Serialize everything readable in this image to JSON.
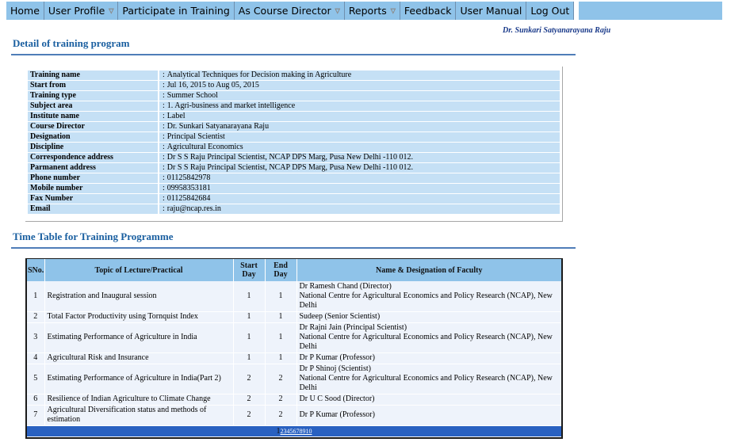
{
  "menu": {
    "items": [
      {
        "label": "Home",
        "dropdown": false
      },
      {
        "label": "User Profile",
        "dropdown": true
      },
      {
        "label": "Participate in Training",
        "dropdown": false
      },
      {
        "label": "As Course Director",
        "dropdown": true
      },
      {
        "label": "Reports",
        "dropdown": true
      },
      {
        "label": "Feedback",
        "dropdown": false
      },
      {
        "label": "User Manual",
        "dropdown": false
      },
      {
        "label": "Log Out",
        "dropdown": false
      }
    ],
    "dropdown_icon": "triangle-down-icon"
  },
  "user": {
    "name": "Dr. Sunkari Satyanarayana Raju"
  },
  "detail": {
    "title": "Detail of training program",
    "rows": [
      {
        "label": "Training name",
        "value": "Analytical Techniques for Decision making in Agriculture"
      },
      {
        "label": "Start from",
        "value": "Jul 16, 2015 to Aug 05, 2015"
      },
      {
        "label": "Training type",
        "value": "Summer School"
      },
      {
        "label": "Subject area",
        "value": "1. Agri-business and market intelligence"
      },
      {
        "label": "Institute name",
        "value": "Label"
      },
      {
        "label": "Course Director",
        "value": "Dr. Sunkari Satyanarayana Raju"
      },
      {
        "label": "Designation",
        "value": "Principal Scientist"
      },
      {
        "label": "Discipline",
        "value": "Agricultural Economics"
      },
      {
        "label": "Correspondence address",
        "value": "Dr S S Raju Principal Scientist, NCAP DPS Marg, Pusa New Delhi -110 012."
      },
      {
        "label": "Parmanent address",
        "value": "Dr S S Raju Principal Scientist, NCAP DPS Marg, Pusa New Delhi -110 012."
      },
      {
        "label": "Phone number",
        "value": "01125842978"
      },
      {
        "label": "Mobile number",
        "value": "09958353181"
      },
      {
        "label": "Fax Number",
        "value": "01125842684"
      },
      {
        "label": "Email",
        "value": "raju@ncap.res.in"
      }
    ],
    "separator": ":"
  },
  "timetable": {
    "title": "Time Table for Training Programme",
    "headers": {
      "sno": "SNo.",
      "topic": "Topic of Lecture/Practical",
      "start_day_1": "Start",
      "start_day_2": "Day",
      "end_day_1": "End",
      "end_day_2": "Day",
      "faculty": "Name & Designation of Faculty"
    },
    "rows": [
      {
        "sno": "1",
        "topic": "Registration and Inaugural session",
        "start": "1",
        "end": "1",
        "faculty": [
          "Dr Ramesh Chand (Director)",
          "National Centre for Agricultural Economics and Policy Research (NCAP), New Delhi"
        ]
      },
      {
        "sno": "2",
        "topic": "Total Factor Productivity using Tornquist Index",
        "start": "1",
        "end": "1",
        "faculty": [
          "Sudeep (Senior Scientist)"
        ]
      },
      {
        "sno": "3",
        "topic": "Estimating Performance of Agriculture in India",
        "start": "1",
        "end": "1",
        "faculty": [
          "Dr Rajni Jain (Principal Scientist)",
          "National Centre for Agricultural Economics and Policy Research (NCAP), New Delhi"
        ]
      },
      {
        "sno": "4",
        "topic": "Agricultural Risk and Insurance",
        "start": "1",
        "end": "1",
        "faculty": [
          "Dr P Kumar (Professor)"
        ]
      },
      {
        "sno": "5",
        "topic": "Estimating Performance of Agriculture in India(Part 2)",
        "start": "2",
        "end": "2",
        "faculty": [
          "Dr P Shinoj (Scientist)",
          "National Centre for Agricultural Economics and Policy Research (NCAP), New Delhi"
        ]
      },
      {
        "sno": "6",
        "topic": "Resilience of Indian Agriculture to Climate Change",
        "start": "2",
        "end": "2",
        "faculty": [
          "Dr U C Sood (Director)"
        ]
      },
      {
        "sno": "7",
        "topic": "Agricultural Diversification status and methods of estimation",
        "start": "2",
        "end": "2",
        "faculty": [
          "Dr P Kumar (Professor)"
        ]
      }
    ],
    "pager": {
      "current": "1",
      "pages": [
        "2",
        "3",
        "4",
        "5",
        "6",
        "7",
        "8",
        "9",
        "10"
      ]
    }
  }
}
